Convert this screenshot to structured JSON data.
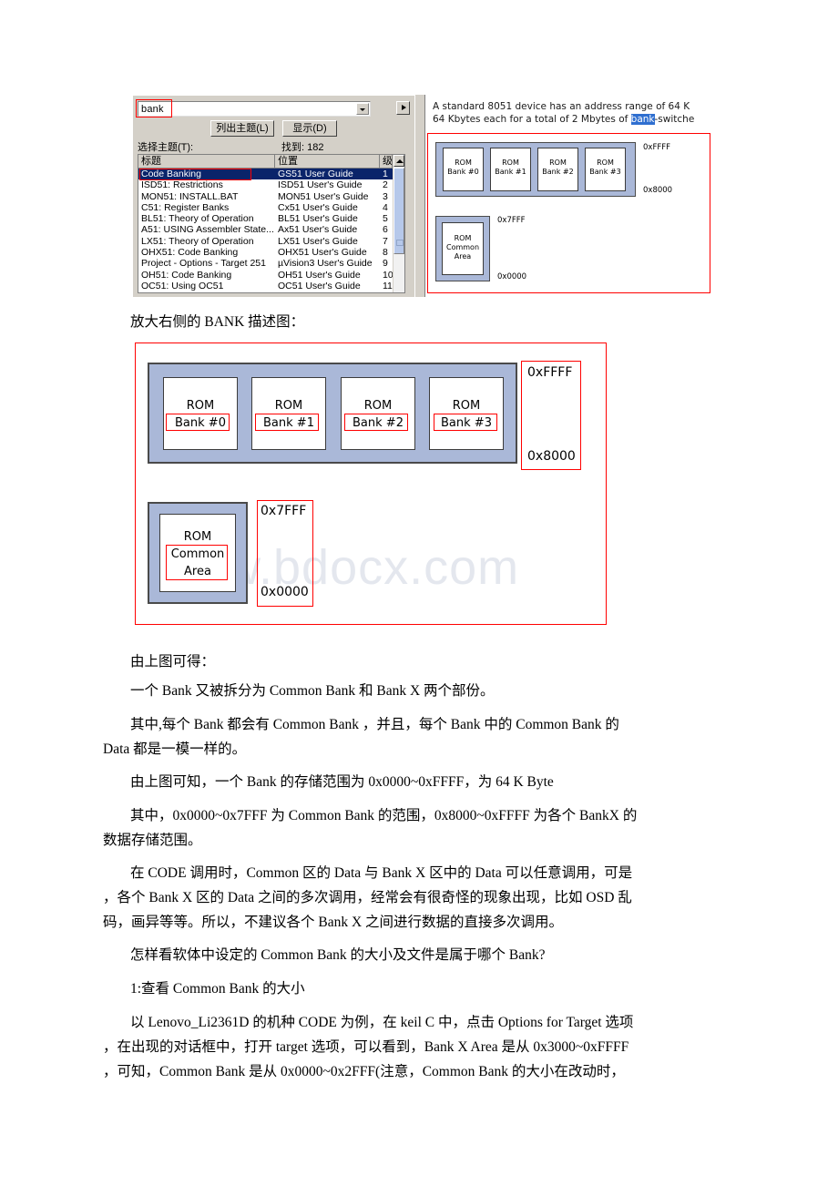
{
  "dialog": {
    "search_input": {
      "value": "bank",
      "placeholder": ""
    },
    "buttons": {
      "list_topics": "列出主题(L)",
      "display": "显示(D)"
    },
    "select_topic_label": "选择主题(T):",
    "found_label": "找到: 182",
    "columns": [
      "标题",
      "位置",
      "级"
    ],
    "rows": [
      {
        "title": "Code Banking",
        "location": "GS51 User Guide",
        "rank": "1",
        "selected": true
      },
      {
        "title": "ISD51: Restrictions",
        "location": "ISD51 User's Guide",
        "rank": "2",
        "selected": false
      },
      {
        "title": "MON51: INSTALL.BAT",
        "location": "MON51 User's Guide",
        "rank": "3",
        "selected": false
      },
      {
        "title": "C51: Register Banks",
        "location": "Cx51 User's Guide",
        "rank": "4",
        "selected": false
      },
      {
        "title": "BL51: Theory of Operation",
        "location": "BL51 User's Guide",
        "rank": "5",
        "selected": false
      },
      {
        "title": "A51: USING Assembler State...",
        "location": "Ax51 User's Guide",
        "rank": "6",
        "selected": false
      },
      {
        "title": "LX51: Theory of Operation",
        "location": "LX51 User's Guide",
        "rank": "7",
        "selected": false
      },
      {
        "title": "OHX51: Code Banking",
        "location": "OHX51 User's Guide",
        "rank": "8",
        "selected": false
      },
      {
        "title": "Project - Options - Target 251",
        "location": "µVision3 User's Guide",
        "rank": "9",
        "selected": false
      },
      {
        "title": "OH51: Code Banking",
        "location": "OH51 User's Guide",
        "rank": "10",
        "selected": false
      },
      {
        "title": "OC51: Using OC51",
        "location": "OC51 User's Guide",
        "rank": "11",
        "selected": false
      }
    ]
  },
  "help_pane": {
    "line1_before": "A standard 8051 device has an address range of 64 K",
    "line2_before": "64 Kbytes each for a total of 2 Mbytes of ",
    "line2_highlight": "bank",
    "line2_after": "-switche"
  },
  "mini_diagram": {
    "banks": [
      {
        "l1": "ROM",
        "l2": "Bank #0"
      },
      {
        "l1": "ROM",
        "l2": "Bank #1"
      },
      {
        "l1": "ROM",
        "l2": "Bank #2"
      },
      {
        "l1": "ROM",
        "l2": "Bank #3"
      }
    ],
    "common": {
      "l1": "ROM",
      "l2": "Common",
      "l3": "Area"
    },
    "addr_top": "0xFFFF",
    "addr_mid": "0x8000",
    "addr_common_top": "0x7FFF",
    "addr_common_bottom": "0x0000"
  },
  "big_diagram": {
    "banks": [
      {
        "l1": "ROM",
        "l2": "Bank #0"
      },
      {
        "l1": "ROM",
        "l2": "Bank #1"
      },
      {
        "l1": "ROM",
        "l2": "Bank #2"
      },
      {
        "l1": "ROM",
        "l2": "Bank #3"
      }
    ],
    "common": {
      "l1": "ROM",
      "l2": "Common",
      "l3": "Area"
    },
    "addr_top": "0xFFFF",
    "addr_mid": "0x8000",
    "addr_common_top": "0x7FFF",
    "addr_common_bottom": "0x0000",
    "watermark": "www.bdocx.com"
  },
  "body": {
    "caption": "放大右侧的 BANK 描述图：",
    "p1": "由上图可得：",
    "p2": "一个 Bank 又被拆分为 Common Bank 和 Bank X 两个部份。",
    "p3_line1": "其中,每个 Bank 都会有 Common Bank ，并且，每个 Bank 中的 Common Bank 的",
    "p3_line2": "Data 都是一模一样的。",
    "p4": "由上图可知，一个 Bank 的存储范围为 0x0000~0xFFFF，为 64 K Byte",
    "p5_line1": "其中，0x0000~0x7FFF 为 Common Bank 的范围，0x8000~0xFFFF 为各个 BankX 的",
    "p5_line2": "数据存储范围。",
    "p6_line1": "在 CODE 调用时，Common 区的 Data 与 Bank X 区中的 Data 可以任意调用，可是",
    "p6_line2": "，各个 Bank X 区的 Data 之间的多次调用，经常会有很奇怪的现象出现，比如 OSD 乱",
    "p6_line3": "码，画异等等。所以，不建议各个 Bank X 之间进行数据的直接多次调用。",
    "p7": "怎样看软体中设定的 Common Bank 的大小及文件是属于哪个 Bank?",
    "p8": "1:查看 Common Bank 的大小",
    "p9_line1": "以 Lenovo_Li2361D 的机种 CODE 为例，在 keil C 中，点击 Options for Target 选项",
    "p9_line2": "，在出现的对话框中，打开 target 选项，可以看到，Bank X Area 是从 0x3000~0xFFFF",
    "p9_line3": "，可知，Common Bank 是从 0x0000~0x2FFF(注意，Common Bank 的大小在改动时，"
  }
}
